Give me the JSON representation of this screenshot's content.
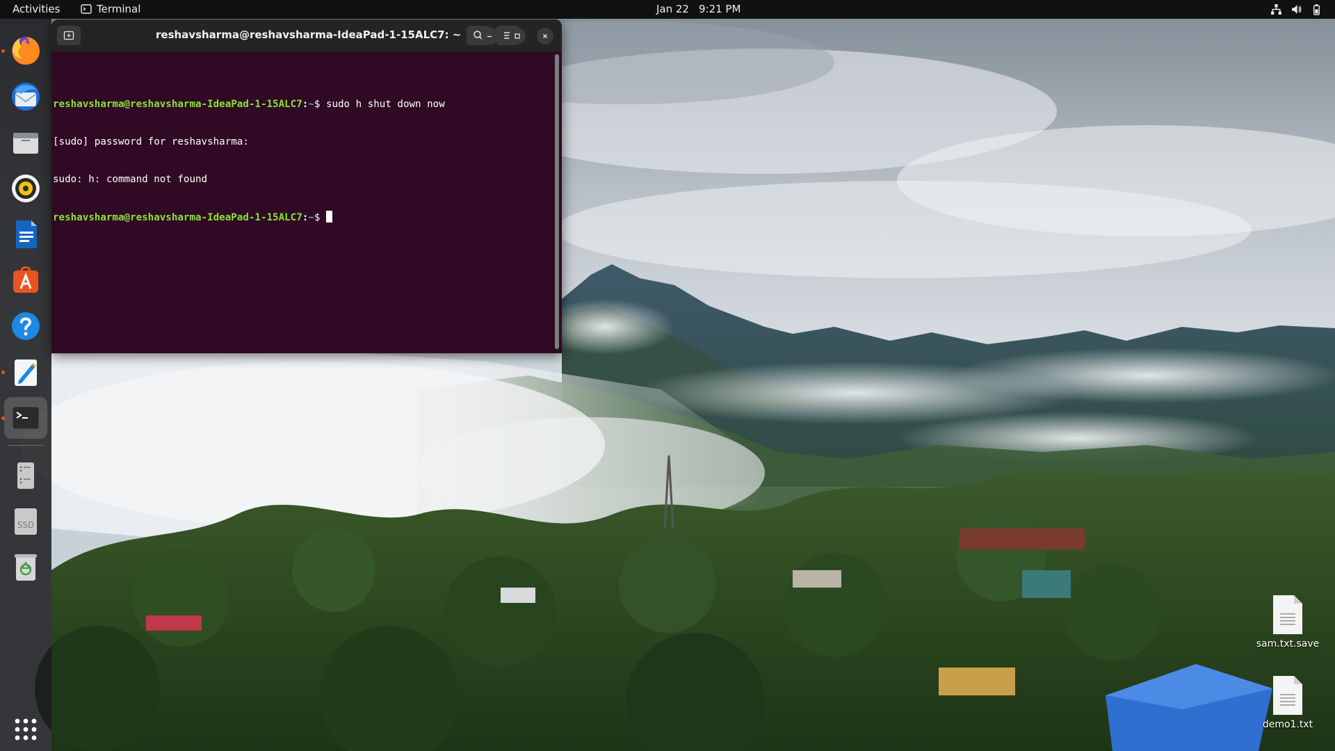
{
  "topbar": {
    "activities": "Activities",
    "app_name": "Terminal",
    "date": "Jan 22",
    "time": "9:21 PM",
    "tray_icons": [
      "network-icon",
      "volume-icon",
      "battery-icon"
    ]
  },
  "dock": {
    "items": [
      {
        "name": "firefox",
        "icon": "firefox-icon",
        "running": true
      },
      {
        "name": "thunderbird",
        "icon": "thunderbird-icon",
        "running": false
      },
      {
        "name": "files",
        "icon": "files-icon",
        "running": false
      },
      {
        "name": "rhythmbox",
        "icon": "rhythmbox-icon",
        "running": false
      },
      {
        "name": "libreoffice-writer",
        "icon": "writer-icon",
        "running": false
      },
      {
        "name": "ubuntu-software",
        "icon": "software-icon",
        "running": false
      },
      {
        "name": "help",
        "icon": "help-icon",
        "running": false
      },
      {
        "name": "text-editor",
        "icon": "text-editor-icon",
        "running": true
      },
      {
        "name": "terminal",
        "icon": "terminal-icon",
        "running": true,
        "active": true
      },
      {
        "name": "disk",
        "icon": "disk-icon"
      },
      {
        "name": "ssd",
        "icon": "ssd-icon",
        "label": "SSD"
      },
      {
        "name": "trash",
        "icon": "trash-icon"
      },
      {
        "name": "show-apps",
        "icon": "app-grid-icon"
      }
    ]
  },
  "terminal": {
    "title": "reshavsharma@reshavsharma-IdeaPad-1-15ALC7: ~",
    "prompt_user": "reshavsharma@reshavsharma-IdeaPad-1-15ALC7",
    "prompt_sep": ":",
    "prompt_path": "~",
    "prompt_symbol": "$ ",
    "lines": [
      {
        "type": "prompt",
        "command": "sudo h shut down now"
      },
      {
        "type": "output",
        "text": "[sudo] password for reshavsharma:"
      },
      {
        "type": "output",
        "text": "sudo: h: command not found"
      },
      {
        "type": "prompt",
        "command": ""
      }
    ]
  },
  "desktop": {
    "icons": [
      {
        "label": "sam.txt.save",
        "icon": "text-file-icon"
      },
      {
        "label": "demo1.txt",
        "icon": "text-file-icon"
      }
    ]
  },
  "colors": {
    "terminal_bg": "#300a24",
    "prompt_user": "#8ae234",
    "prompt_path": "#729fcf",
    "accent": "#e95420"
  }
}
